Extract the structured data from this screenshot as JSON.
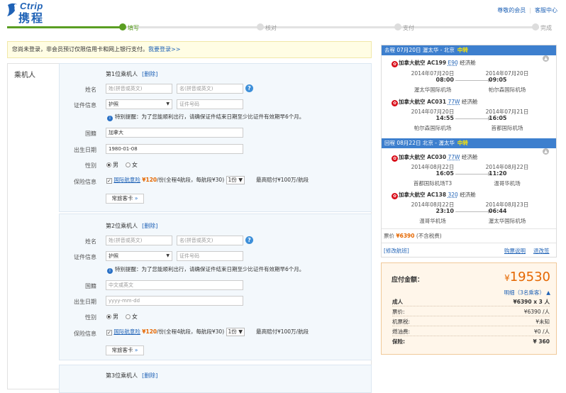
{
  "header": {
    "logo_en": "Ctrip",
    "logo_cn": "携程",
    "links": [
      "尊敬的会员",
      "客服中心"
    ]
  },
  "progress": {
    "steps": [
      "填写",
      "核对",
      "支付",
      "完成"
    ],
    "accent": "#5a9e22"
  },
  "notice": {
    "text": "您尚未登录，非会员预订仅限信用卡和网上银行支付。",
    "link": "我要登录>>"
  },
  "section_label": "乘机人",
  "passengers": [
    {
      "title": "第1位乘机人",
      "delete": "[删除]",
      "last_name": "姓(拼音或英文)",
      "first_name": "名(拼音或英文)",
      "id_type": "护照",
      "id_no": "证件号码",
      "tip": "特别提醒：为了您能顺利出行，请确保证件结束日期至少比证件有效期早6个月。",
      "nationality": "加拿大",
      "birth": "1980-01-08",
      "gender_m": "男",
      "gender_f": "女",
      "insurance": "国际航意险",
      "price": "¥120",
      "price_note": "/份(全程4航段，每航段¥30)",
      "copies": "1份",
      "cover": "最高赔付¥100万/航段",
      "freq": "常旅客卡",
      "freq_arrow": "»"
    },
    {
      "title": "第2位乘机人",
      "delete": "[删除]",
      "last_name": "姓(拼音或英文)",
      "first_name": "名(拼音或英文)",
      "id_type": "护照",
      "id_no": "证件号码",
      "tip": "特别提醒：为了您能顺利出行，请确保证件结束日期至少比证件有效期早6个月。",
      "nationality": "中文或英文",
      "birth": "yyyy-mm-dd",
      "gender_m": "男",
      "gender_f": "女",
      "insurance": "国际航意险",
      "price": "¥120",
      "price_note": "/份(全程4航段，每航段¥30)",
      "copies": "1份",
      "cover": "最高赔付¥100万/航段",
      "freq": "常旅客卡",
      "freq_arrow": "»"
    },
    {
      "title": "第3位乘机人",
      "delete": "[删除]"
    }
  ],
  "labels": {
    "name": "姓名",
    "id": "证件信息",
    "nationality": "国籍",
    "birth": "出生日期",
    "gender": "性别",
    "insurance": "保险信息"
  },
  "itinerary": {
    "outbound": {
      "header": "去程 07月20日 渥太华 - 北京",
      "tag": "中转",
      "flights": [
        {
          "airline": "加拿大航空 AC199",
          "model": "E90",
          "cabin": "经济舱",
          "dep_date": "2014年07月20日",
          "dep_time": "08:00",
          "dep_apt": "渥太华国际机场",
          "arr_date": "2014年07月20日",
          "arr_time": "09:05",
          "arr_apt": "帕尔森国际机场"
        },
        {
          "airline": "加拿大航空 AC031",
          "model": "77W",
          "cabin": "经济舱",
          "dep_date": "2014年07月20日",
          "dep_time": "14:55",
          "dep_apt": "帕尔森国际机场",
          "arr_date": "2014年07月21日",
          "arr_time": "16:05",
          "arr_apt": "首都国际机场"
        }
      ]
    },
    "return": {
      "header": "回程 08月22日 北京 - 渥太华",
      "tag": "中转",
      "flights": [
        {
          "airline": "加拿大航空 AC030",
          "model": "77W",
          "cabin": "经济舱",
          "dep_date": "2014年08月22日",
          "dep_time": "16:05",
          "dep_apt": "首都国际机场T3",
          "arr_date": "2014年08月22日",
          "arr_time": "11:20",
          "arr_apt": "温哥华机场"
        },
        {
          "airline": "加拿大航空 AC138",
          "model": "320",
          "cabin": "经济舱",
          "dep_date": "2014年08月22日",
          "dep_time": "23:10",
          "dep_apt": "温哥华机场",
          "arr_date": "2014年08月23日",
          "arr_time": "06:44",
          "arr_apt": "渥太华国际机场"
        }
      ]
    },
    "fare_label": "票价",
    "fare": "¥6390",
    "fare_note": "(不含税费)",
    "modify": "[修改航班]",
    "rules": "购票说明",
    "refund": "退改签"
  },
  "payment": {
    "label": "应付金额：",
    "currency": "¥",
    "total": "19530",
    "detail": "明细（3名乘客）",
    "rows": [
      {
        "k": "成人",
        "v": "¥6390 x 3 人",
        "bold": true
      },
      {
        "k": "票价:",
        "v": "¥6390 /人"
      },
      {
        "k": "机票税:",
        "v": "¥未知"
      },
      {
        "k": "燃油费:",
        "v": "¥0 /人"
      },
      {
        "k": "保险:",
        "v": "¥ 360",
        "bold": true
      }
    ]
  }
}
